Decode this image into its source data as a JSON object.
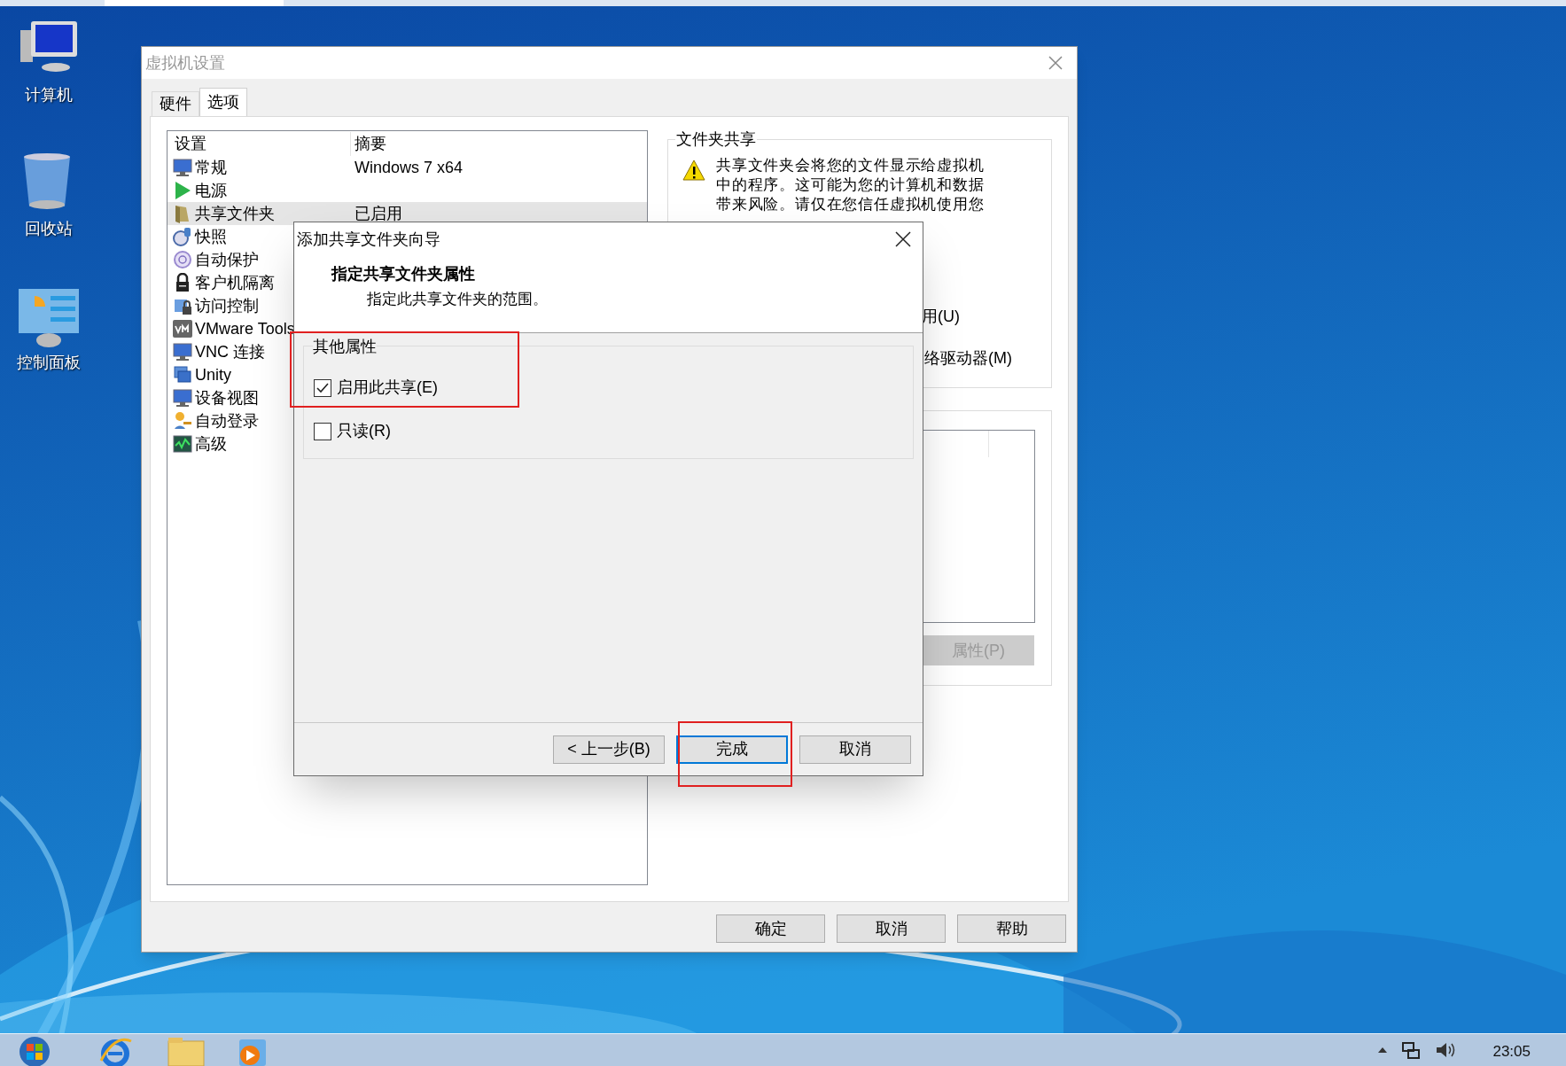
{
  "desktop_icons": [
    {
      "label": "计算机",
      "kind": "computer"
    },
    {
      "label": "回收站",
      "kind": "recycle"
    },
    {
      "label": "控制面板",
      "kind": "control"
    }
  ],
  "window": {
    "title": "虚拟机设置",
    "tabs": [
      {
        "label": "硬件",
        "selected": false
      },
      {
        "label": "选项",
        "selected": true
      }
    ],
    "settings_list": {
      "columns": [
        "设置",
        "摘要"
      ],
      "rows": [
        {
          "name": "常规",
          "summary": "Windows 7 x64",
          "kind": "monitor",
          "selected": false
        },
        {
          "name": "电源",
          "kind": "play",
          "selected": false
        },
        {
          "name": "共享文件夹",
          "summary": "已启用",
          "kind": "folder",
          "selected": true
        },
        {
          "name": "快照",
          "kind": "clock",
          "selected": false
        },
        {
          "name": "自动保护",
          "kind": "shield",
          "selected": false
        },
        {
          "name": "客户机隔离",
          "kind": "lock",
          "selected": false
        },
        {
          "name": "访问控制",
          "kind": "access",
          "selected": false
        },
        {
          "name": "VMware Tools",
          "kind": "vm",
          "selected": false
        },
        {
          "name": "VNC 连接",
          "kind": "monitor",
          "selected": false
        },
        {
          "name": "Unity",
          "kind": "windows",
          "selected": false
        },
        {
          "name": "设备视图",
          "kind": "monitor",
          "selected": false
        },
        {
          "name": "自动登录",
          "kind": "key",
          "selected": false
        },
        {
          "name": "高级",
          "kind": "chart",
          "selected": false
        }
      ]
    },
    "folder_sharing": {
      "title": "文件夹共享",
      "warning": "共享文件夹会将您的文件显示给虚拟机中的程序。这可能为您的计算机和数据带来风险。请仅在您信任虚拟机使用您",
      "options": [
        "用(U)",
        "络驱动器(M)"
      ]
    },
    "properties_button": {
      "label": "属性(P)",
      "disabled": true
    },
    "buttons": [
      "确定",
      "取消",
      "帮助"
    ]
  },
  "dialog": {
    "title": "添加共享文件夹向导",
    "heading": "指定共享文件夹属性",
    "subheading": "指定此共享文件夹的范围。",
    "group_title": "其他属性",
    "checkboxes": [
      {
        "label": "启用此共享(E)",
        "checked": true
      },
      {
        "label": "只读(R)",
        "checked": false
      }
    ],
    "buttons": [
      {
        "label": "< 上一步(B)",
        "default": false
      },
      {
        "label": "完成",
        "default": true
      },
      {
        "label": "取消",
        "default": false
      }
    ]
  },
  "taskbar": {
    "time": "23:05"
  }
}
